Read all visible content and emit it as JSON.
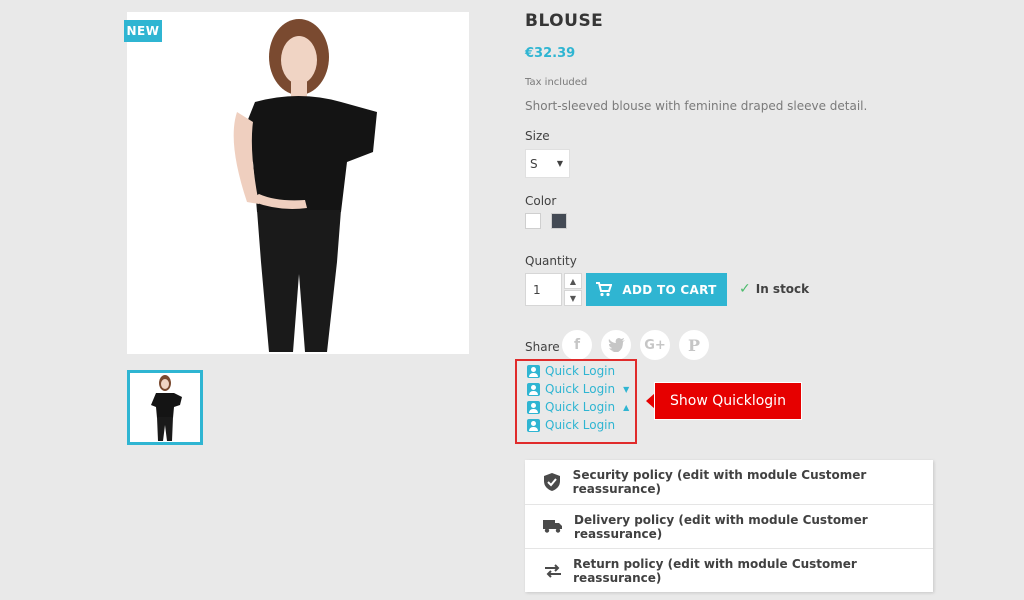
{
  "product": {
    "badge": "NEW",
    "title": "BLOUSE",
    "price": "€32.39",
    "tax": "Tax included",
    "description": "Short-sleeved blouse with feminine draped sleeve detail."
  },
  "variants": {
    "size_label": "Size",
    "size_value": "S",
    "color_label": "Color",
    "colors": [
      "#ffffff",
      "#434a54"
    ]
  },
  "purchase": {
    "quantity_label": "Quantity",
    "quantity_value": "1",
    "add_to_cart": "ADD TO CART",
    "stock": "In stock"
  },
  "share": {
    "label": "Share",
    "icons": [
      "facebook-icon",
      "twitter-icon",
      "google-plus-icon",
      "pinterest-icon"
    ]
  },
  "quicklogin": {
    "items": [
      "Quick Login",
      "Quick Login",
      "Quick Login",
      "Quick Login"
    ],
    "callout": "Show Quicklogin"
  },
  "reassurance": {
    "items": [
      "Security policy (edit with module Customer reassurance)",
      "Delivery policy (edit with module Customer reassurance)",
      "Return policy (edit with module Customer reassurance)"
    ]
  },
  "colors": {
    "accent": "#2fb5d2",
    "callout": "#e60000"
  }
}
